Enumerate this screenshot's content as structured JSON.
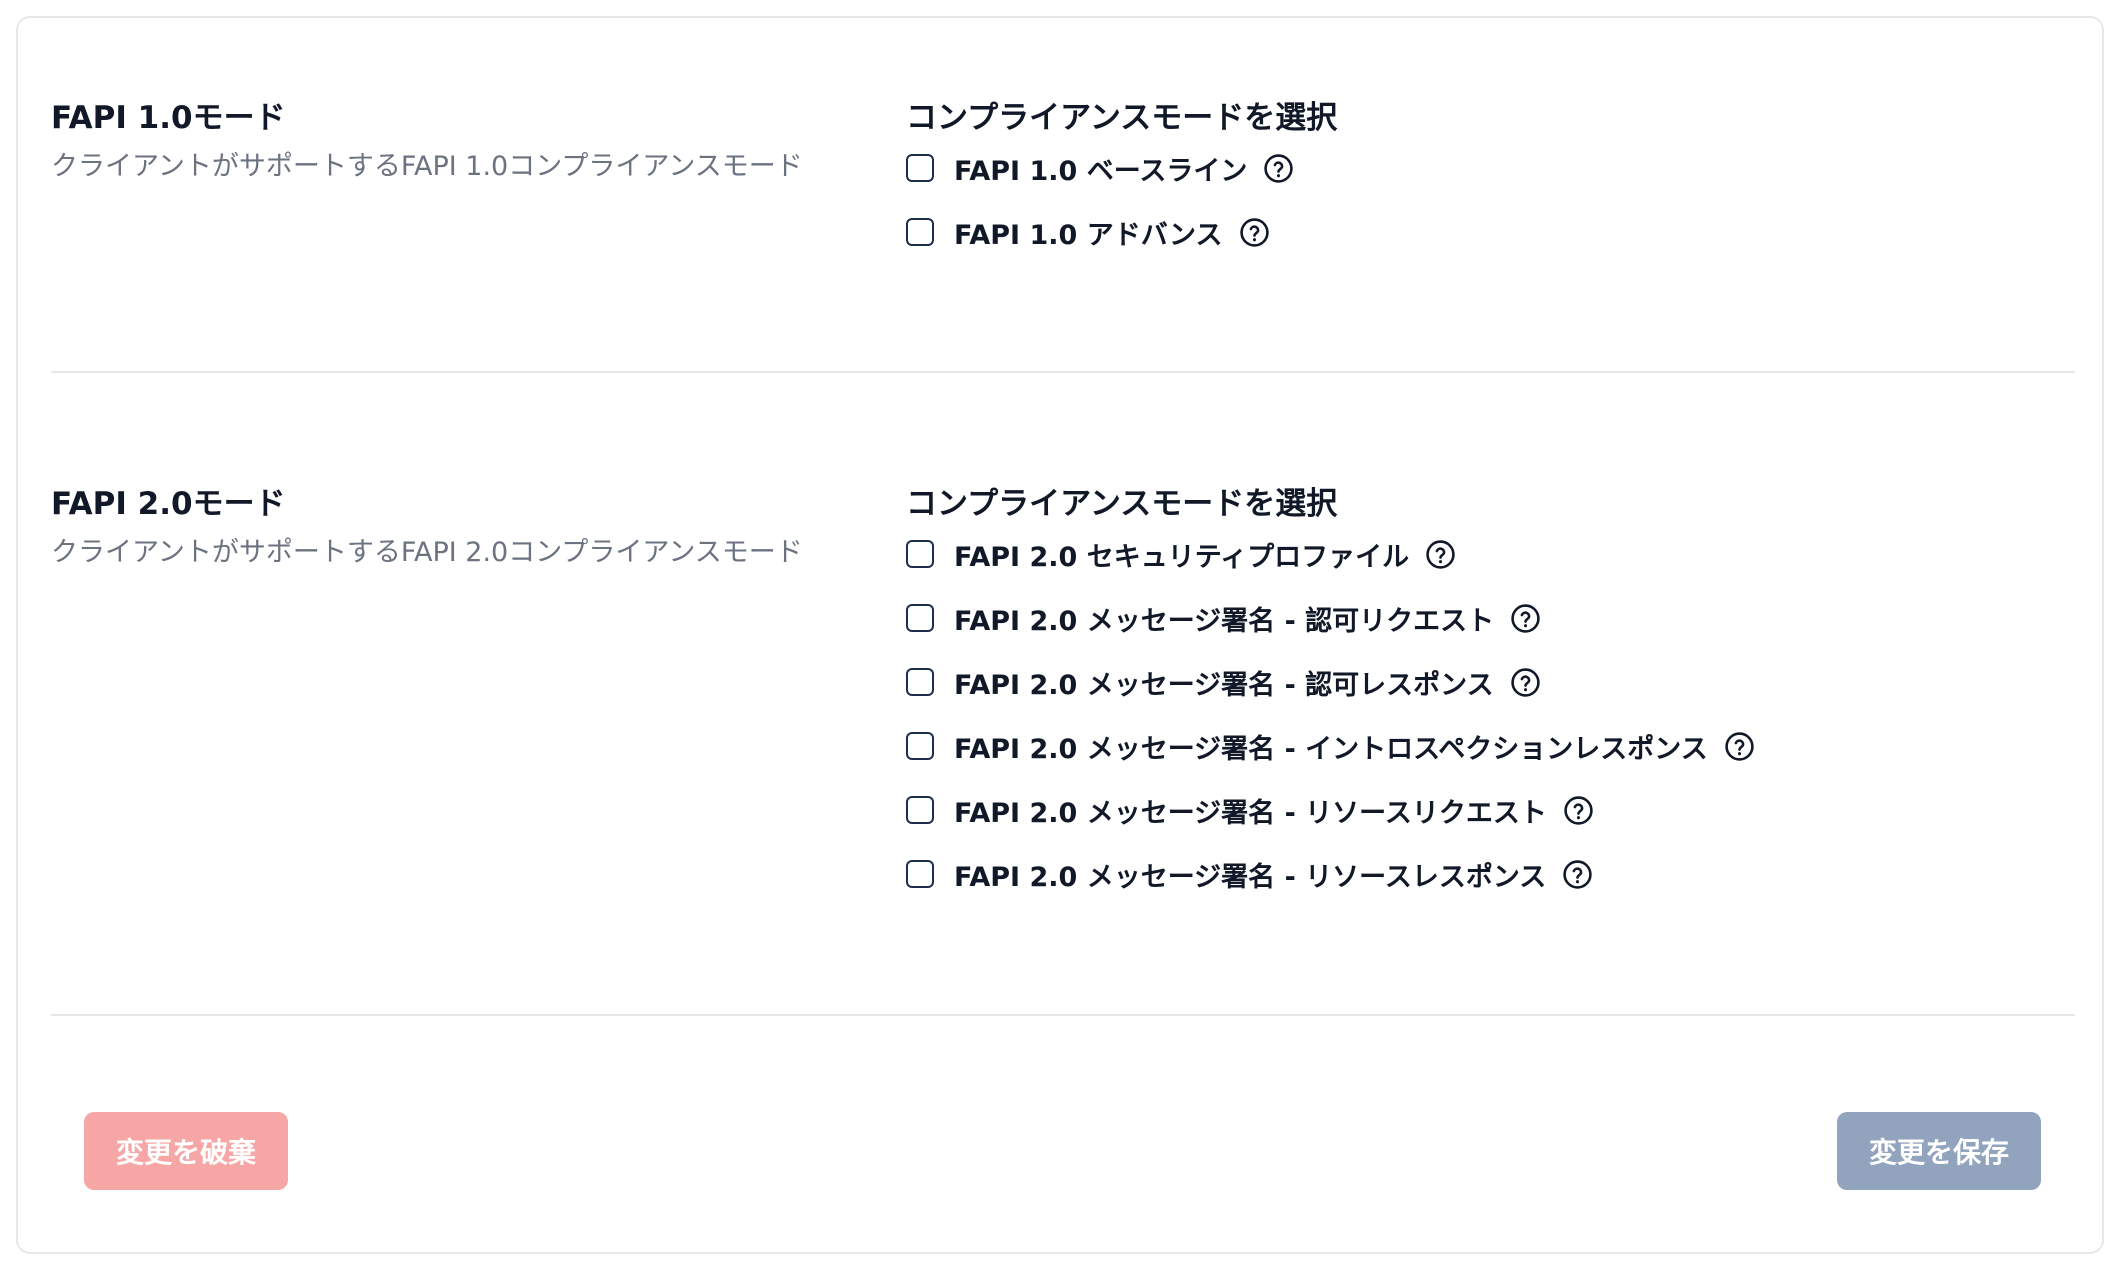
{
  "fapi1": {
    "title": "FAPI 1.0モード",
    "description": "クライアントがサポートするFAPI 1.0コンプライアンスモード",
    "options_title": "コンプライアンスモードを選択",
    "options": [
      {
        "label": "FAPI 1.0 ベースライン",
        "checked": false
      },
      {
        "label": "FAPI 1.0 アドバンス",
        "checked": false
      }
    ]
  },
  "fapi2": {
    "title": "FAPI 2.0モード",
    "description": "クライアントがサポートするFAPI 2.0コンプライアンスモード",
    "options_title": "コンプライアンスモードを選択",
    "options": [
      {
        "label": "FAPI 2.0 セキュリティプロファイル",
        "checked": false
      },
      {
        "label": "FAPI 2.0 メッセージ署名 - 認可リクエスト",
        "checked": false
      },
      {
        "label": "FAPI 2.0 メッセージ署名 - 認可レスポンス",
        "checked": false
      },
      {
        "label": "FAPI 2.0 メッセージ署名 - イントロスペクションレスポンス",
        "checked": false
      },
      {
        "label": "FAPI 2.0 メッセージ署名 - リソースリクエスト",
        "checked": false
      },
      {
        "label": "FAPI 2.0 メッセージ署名 - リソースレスポンス",
        "checked": false
      }
    ]
  },
  "actions": {
    "discard_label": "変更を破棄",
    "save_label": "変更を保存"
  },
  "icons": {
    "help": "question-circle-icon"
  },
  "colors": {
    "discard_button": "#f7a6a6",
    "save_button": "#91a3bd",
    "checkbox_border": "#1f2d4d",
    "description_text": "#6b7280"
  }
}
